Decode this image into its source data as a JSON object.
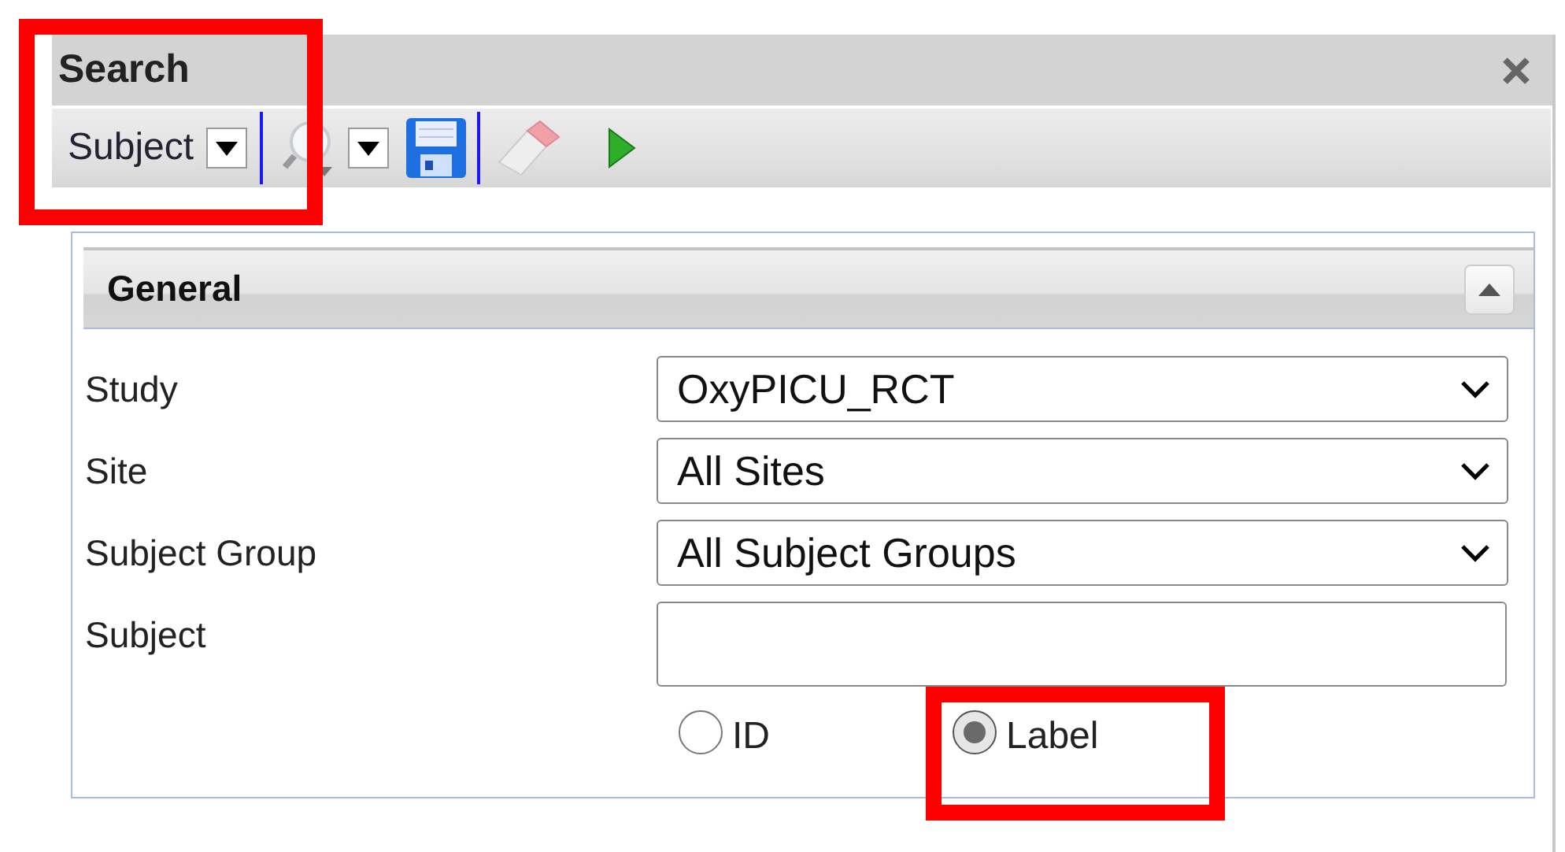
{
  "panel": {
    "title": "Search"
  },
  "toolbar": {
    "entity": "Subject"
  },
  "section": {
    "title": "General",
    "expanded": true
  },
  "fields": [
    {
      "kind": "select",
      "label": "Study",
      "value": "OxyPICU_RCT"
    },
    {
      "kind": "select",
      "label": "Site",
      "value": "All Sites"
    },
    {
      "kind": "select",
      "label": "Subject Group",
      "value": "All Subject Groups"
    },
    {
      "kind": "text",
      "label": "Subject"
    }
  ],
  "match_by": [
    {
      "label": "ID",
      "selected": false
    },
    {
      "label": "Label",
      "selected": true
    }
  ]
}
